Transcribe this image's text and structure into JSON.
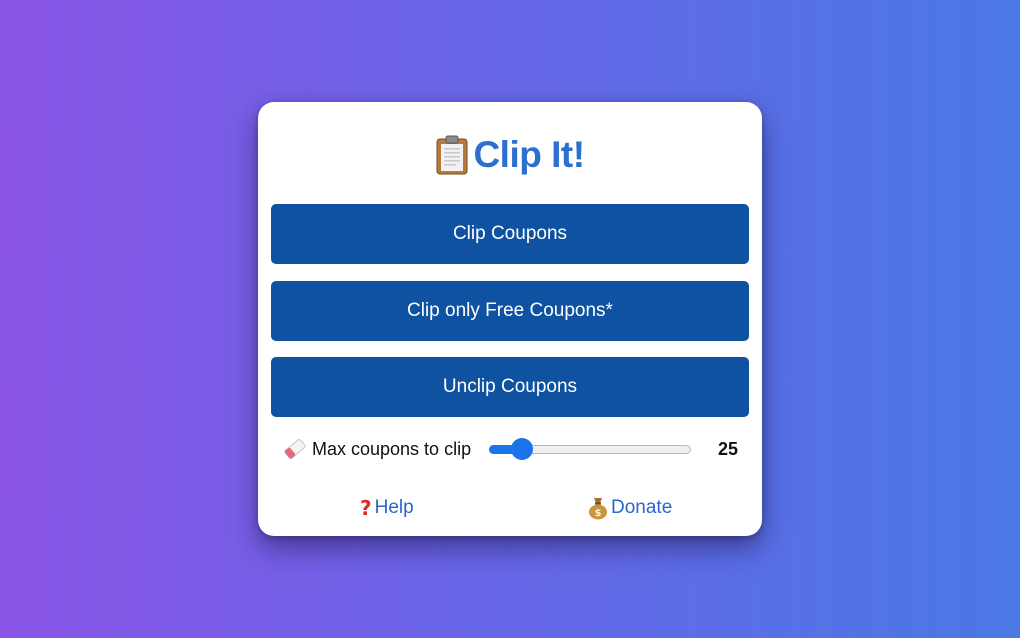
{
  "app": {
    "title": "Clip It!",
    "title_icon": "clipboard-icon"
  },
  "buttons": {
    "clip_coupons": "Clip Coupons",
    "clip_free": "Clip only Free Coupons*",
    "unclip": "Unclip Coupons"
  },
  "slider": {
    "icon": "eraser-icon",
    "label": "Max coupons to clip",
    "value": "25",
    "fill_fraction": 0.12
  },
  "links": {
    "help_icon": "question-mark-icon",
    "help": "Help",
    "donate_icon": "money-bag-icon",
    "donate": "Donate"
  },
  "colors": {
    "button_bg": "#0e52a1",
    "title_text": "#2b6fcf",
    "link_text": "#2a67c9",
    "slider_accent": "#1a73e8"
  }
}
